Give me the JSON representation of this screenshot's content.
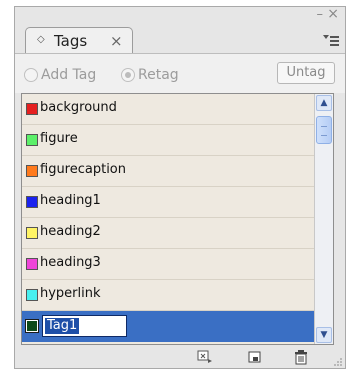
{
  "window": {
    "minimize_glyph": "–",
    "close_glyph": "×"
  },
  "tab": {
    "label": "Tags",
    "close_glyph": "×",
    "diamond_glyph": "◇"
  },
  "toolbar": {
    "add_tag_label": "Add Tag",
    "retag_label": "Retag",
    "untag_label": "Untag"
  },
  "tags": [
    {
      "name": "background",
      "color": "#e52020"
    },
    {
      "name": "figure",
      "color": "#5cf06a"
    },
    {
      "name": "figurecaption",
      "color": "#ff7a1c"
    },
    {
      "name": "heading1",
      "color": "#1a22ee"
    },
    {
      "name": "heading2",
      "color": "#fff464"
    },
    {
      "name": "heading3",
      "color": "#ee46d8"
    },
    {
      "name": "hyperlink",
      "color": "#48efef"
    },
    {
      "name": "Tag1",
      "color": "#0e4a18"
    }
  ],
  "footer": {
    "icons": [
      "tag-element-icon",
      "new-tag-icon",
      "trash-icon"
    ]
  },
  "colors": {
    "selection": "#3a6fc4",
    "list_background": "#eee9e0"
  }
}
